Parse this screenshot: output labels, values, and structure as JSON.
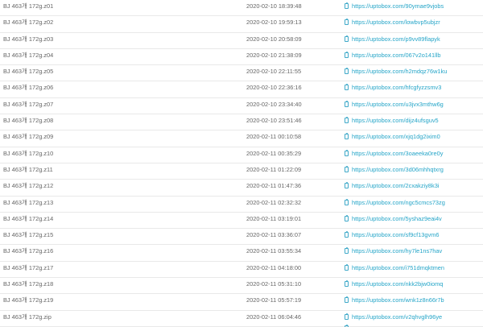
{
  "rows": [
    {
      "name": "BJ 463개 172g.z01",
      "date": "2020-02-10 18:39:48",
      "url": "https://uptobox.com/90ymae9vjobs",
      "icon": "clipboard-icon"
    },
    {
      "name": "BJ 463개 172g.z02",
      "date": "2020-02-10 19:59:13",
      "url": "https://uptobox.com/lowbvp5ubjzr",
      "icon": "clipboard-icon"
    },
    {
      "name": "BJ 463개 172g.z03",
      "date": "2020-02-10 20:58:09",
      "url": "https://uptobox.com/p9vv89flapyk",
      "icon": "clipboard-icon"
    },
    {
      "name": "BJ 463개 172g.z04",
      "date": "2020-02-10 21:38:09",
      "url": "https://uptobox.com/067v2o141llb",
      "icon": "clipboard-icon"
    },
    {
      "name": "BJ 463개 172g.z05",
      "date": "2020-02-10 22:11:55",
      "url": "https://uptobox.com/h2mdqz76w1ku",
      "icon": "clipboard-icon"
    },
    {
      "name": "BJ 463개 172g.z06",
      "date": "2020-02-10 22:36:16",
      "url": "https://uptobox.com/hfcgfyzzsmv3",
      "icon": "clipboard-icon"
    },
    {
      "name": "BJ 463개 172g.z07",
      "date": "2020-02-10 23:34:40",
      "url": "https://uptobox.com/u3jvx3mthw6g",
      "icon": "clipboard-icon"
    },
    {
      "name": "BJ 463개 172g.z08",
      "date": "2020-02-10 23:51:46",
      "url": "https://uptobox.com/dijz4ufsguv5",
      "icon": "clipboard-icon"
    },
    {
      "name": "BJ 463개 172g.z09",
      "date": "2020-02-11 00:10:58",
      "url": "https://uptobox.com/xjq1dg2ixim0",
      "icon": "clipboard-icon"
    },
    {
      "name": "BJ 463개 172g.z10",
      "date": "2020-02-11 00:35:29",
      "url": "https://uptobox.com/3oaeeka0re0y",
      "icon": "clipboard-icon"
    },
    {
      "name": "BJ 463개 172g.z11",
      "date": "2020-02-11 01:22:09",
      "url": "https://uptobox.com/3d06mhhqtxrg",
      "icon": "clipboard-icon"
    },
    {
      "name": "BJ 463개 172g.z12",
      "date": "2020-02-11 01:47:36",
      "url": "https://uptobox.com/2cxakziy8k3i",
      "icon": "clipboard-icon"
    },
    {
      "name": "BJ 463개 172g.z13",
      "date": "2020-02-11 02:32:32",
      "url": "https://uptobox.com/ngc5cmcs73zg",
      "icon": "clipboard-icon"
    },
    {
      "name": "BJ 463개 172g.z14",
      "date": "2020-02-11 03:19:01",
      "url": "https://uptobox.com/5yshaz9eai4v",
      "icon": "clipboard-icon"
    },
    {
      "name": "BJ 463개 172g.z15",
      "date": "2020-02-11 03:36:07",
      "url": "https://uptobox.com/sf9cf13gvm6",
      "icon": "clipboard-icon"
    },
    {
      "name": "BJ 463개 172g.z16",
      "date": "2020-02-11 03:55:34",
      "url": "https://uptobox.com/hy7le1ns7hav",
      "icon": "clipboard-icon"
    },
    {
      "name": "BJ 463개 172g.z17",
      "date": "2020-02-11 04:18:00",
      "url": "https://uptobox.com/i751dmqktmen",
      "icon": "clipboard-icon"
    },
    {
      "name": "BJ 463개 172g.z18",
      "date": "2020-02-11 05:31:10",
      "url": "https://uptobox.com/nkk2bjw0iomq",
      "icon": "clipboard-icon"
    },
    {
      "name": "BJ 463개 172g.z19",
      "date": "2020-02-11 05:57:19",
      "url": "https://uptobox.com/wnk1z8n66r7b",
      "icon": "clipboard-icon"
    },
    {
      "name": "BJ 463개 172g.zip",
      "date": "2020-02-11 06:04:46",
      "url": "https://uptobox.com/v2qhvglh96ye",
      "icon": "clipboard-icon"
    },
    {
      "name": "",
      "date": "",
      "url": "",
      "icon": "clipboard-icon"
    }
  ],
  "colors": {
    "link": "#25a5c8",
    "text": "#666666",
    "divider": "#e9e9e9"
  }
}
